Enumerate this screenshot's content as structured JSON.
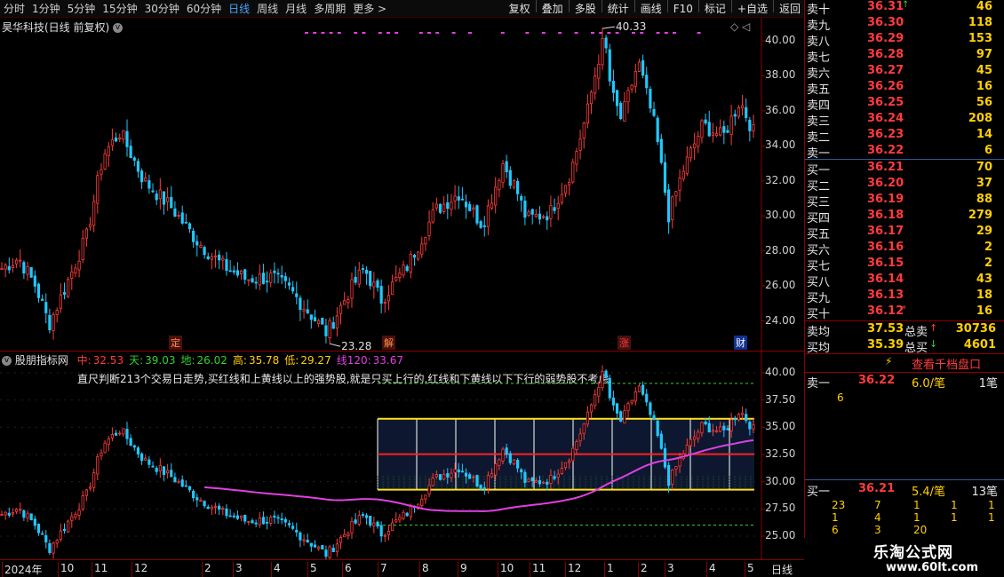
{
  "toolbar": {
    "left": [
      "分时",
      "1分钟",
      "5分钟",
      "15分钟",
      "30分钟",
      "60分钟",
      "日线",
      "周线",
      "月线",
      "多周期",
      "更多 >"
    ],
    "active": "日线",
    "right": [
      "复权",
      "叠加",
      "多股",
      "统计",
      "画线",
      "F10",
      "标记",
      "+自选",
      "返回"
    ]
  },
  "main": {
    "title": "昊华科技(日线 前复权)",
    "circle": "v",
    "right_markers": "◇ ◁",
    "hi_label": "40.33",
    "lo_label": "23.28",
    "event_tags": [
      "定",
      "解",
      "涨",
      "财"
    ],
    "y_labels": [
      "40.00",
      "38.00",
      "36.00",
      "34.00",
      "32.00",
      "30.00",
      "28.00",
      "26.00",
      "24.00"
    ]
  },
  "indicator": {
    "name": "股朋指标网",
    "values": [
      {
        "label": "中:",
        "value": "32.53",
        "color": "#ff3b3b"
      },
      {
        "label": "天:",
        "value": "39.03",
        "color": "#30d030"
      },
      {
        "label": "地:",
        "value": "26.02",
        "color": "#30d030"
      },
      {
        "label": "高:",
        "value": "35.78",
        "color": "#ffd000"
      },
      {
        "label": "低:",
        "value": "29.27",
        "color": "#ffd000"
      },
      {
        "label": "线120:",
        "value": "33.67",
        "color": "#e040e0"
      }
    ],
    "note": "直尺判断213个交易日走势,买红线和上黄线以上的强势股,就是只买上行的,红线和下黄线以下下行的弱势股不考虑.",
    "y_labels": [
      "40.00",
      "37.50",
      "35.00",
      "32.50",
      "30.00",
      "27.50",
      "25.00"
    ]
  },
  "xaxis": {
    "labels": [
      "2024年",
      "10",
      "11",
      "12",
      "2",
      "3",
      "4",
      "5",
      "6",
      "7",
      "8",
      "9",
      "10",
      "11",
      "12",
      "1",
      "2",
      "3",
      "4",
      "5"
    ],
    "period": "日线"
  },
  "orderbook": {
    "sell": [
      {
        "label": "卖十",
        "price": "36.31",
        "vol": "46",
        "mark": "↑"
      },
      {
        "label": "卖九",
        "price": "36.30",
        "vol": "118",
        "mark": ""
      },
      {
        "label": "卖八",
        "price": "36.29",
        "vol": "153",
        "mark": ""
      },
      {
        "label": "卖七",
        "price": "36.28",
        "vol": "97",
        "mark": ""
      },
      {
        "label": "卖六",
        "price": "36.27",
        "vol": "45",
        "mark": ""
      },
      {
        "label": "卖五",
        "price": "36.26",
        "vol": "16",
        "mark": ""
      },
      {
        "label": "卖四",
        "price": "36.25",
        "vol": "56",
        "mark": ""
      },
      {
        "label": "卖三",
        "price": "36.24",
        "vol": "208",
        "mark": ""
      },
      {
        "label": "卖二",
        "price": "36.23",
        "vol": "14",
        "mark": ""
      },
      {
        "label": "卖一",
        "price": "36.22",
        "vol": "6",
        "mark": ""
      }
    ],
    "buy": [
      {
        "label": "买一",
        "price": "36.21",
        "vol": "70",
        "mark": ""
      },
      {
        "label": "买二",
        "price": "36.20",
        "vol": "37",
        "mark": ""
      },
      {
        "label": "买三",
        "price": "36.19",
        "vol": "88",
        "mark": ""
      },
      {
        "label": "买四",
        "price": "36.18",
        "vol": "279",
        "mark": ""
      },
      {
        "label": "买五",
        "price": "36.17",
        "vol": "29",
        "mark": ""
      },
      {
        "label": "买六",
        "price": "36.16",
        "vol": "2",
        "mark": ""
      },
      {
        "label": "买七",
        "price": "36.15",
        "vol": "2",
        "mark": ""
      },
      {
        "label": "买八",
        "price": "36.14",
        "vol": "43",
        "mark": ""
      },
      {
        "label": "买九",
        "price": "36.13",
        "vol": "18",
        "mark": ""
      },
      {
        "label": "买十",
        "price": "36.12",
        "vol": "16",
        "mark": "*"
      }
    ],
    "avg_sell": {
      "label": "卖均",
      "price": "37.53",
      "total_label": "总卖",
      "total": "30736"
    },
    "avg_buy": {
      "label": "买均",
      "price": "35.39",
      "total_label": "总买",
      "total": "4601"
    },
    "qianda_button": "查看千档盘口",
    "qd_sell": {
      "label": "卖一",
      "price": "36.22",
      "per": "6.0/笔",
      "count": "1笔",
      "qty": "6"
    },
    "qd_buy": {
      "label": "买一",
      "price": "36.21",
      "per": "5.4/笔",
      "count": "13笔"
    },
    "qd_rows": [
      [
        "23",
        "7",
        "1",
        "1",
        "1"
      ],
      [
        "1",
        "4",
        "1",
        "1",
        "1"
      ],
      [
        "6",
        "3",
        "20"
      ]
    ]
  },
  "watermark": {
    "title": "乐淘公式网",
    "url": "www.60lt.com"
  },
  "colors": {
    "up": "#ff3b3b",
    "down": "#20c8ff",
    "ma": "#e040e0",
    "band": "#ffd000",
    "mid": "#ff2020"
  }
}
